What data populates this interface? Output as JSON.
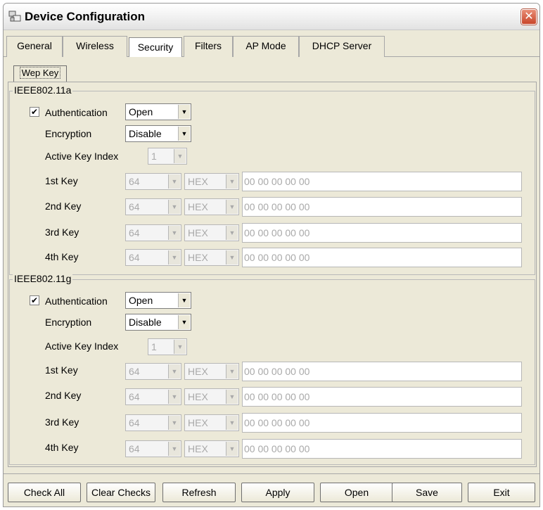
{
  "window": {
    "title": "Device Configuration",
    "app_icon": "network-config-icon",
    "close_icon": "close-icon"
  },
  "tabs": [
    {
      "label": "General",
      "active": false
    },
    {
      "label": "Wireless",
      "active": false
    },
    {
      "label": "Security",
      "active": true
    },
    {
      "label": "Filters",
      "active": false
    },
    {
      "label": "AP Mode",
      "active": false
    },
    {
      "label": "DHCP Server",
      "active": false
    }
  ],
  "subtab": {
    "label": "Wep Key"
  },
  "groups": [
    {
      "title": "IEEE802.11a",
      "authentication": {
        "label": "Authentication",
        "checked": true,
        "value": "Open"
      },
      "encryption": {
        "label": "Encryption",
        "value": "Disable"
      },
      "active_key": {
        "label": "Active Key Index",
        "value": "1"
      },
      "keys": [
        {
          "label": "1st Key",
          "length": "64",
          "format": "HEX",
          "value": "00 00 00 00 00"
        },
        {
          "label": "2nd Key",
          "length": "64",
          "format": "HEX",
          "value": "00 00 00 00 00"
        },
        {
          "label": "3rd Key",
          "length": "64",
          "format": "HEX",
          "value": "00 00 00 00 00"
        },
        {
          "label": "4th Key",
          "length": "64",
          "format": "HEX",
          "value": "00 00 00 00 00"
        }
      ]
    },
    {
      "title": "IEEE802.11g",
      "authentication": {
        "label": "Authentication",
        "checked": true,
        "value": "Open"
      },
      "encryption": {
        "label": "Encryption",
        "value": "Disable"
      },
      "active_key": {
        "label": "Active Key Index",
        "value": "1"
      },
      "keys": [
        {
          "label": "1st Key",
          "length": "64",
          "format": "HEX",
          "value": "00 00 00 00 00"
        },
        {
          "label": "2nd Key",
          "length": "64",
          "format": "HEX",
          "value": "00 00 00 00 00"
        },
        {
          "label": "3rd Key",
          "length": "64",
          "format": "HEX",
          "value": "00 00 00 00 00"
        },
        {
          "label": "4th Key",
          "length": "64",
          "format": "HEX",
          "value": "00 00 00 00 00"
        }
      ]
    }
  ],
  "buttons": {
    "check_all": "Check All",
    "clear_checks": "Clear Checks",
    "refresh": "Refresh",
    "apply": "Apply",
    "open": "Open",
    "save": "Save",
    "exit": "Exit"
  },
  "glyphs": {
    "check": "✔",
    "arrow": "▼",
    "close": "✕"
  }
}
